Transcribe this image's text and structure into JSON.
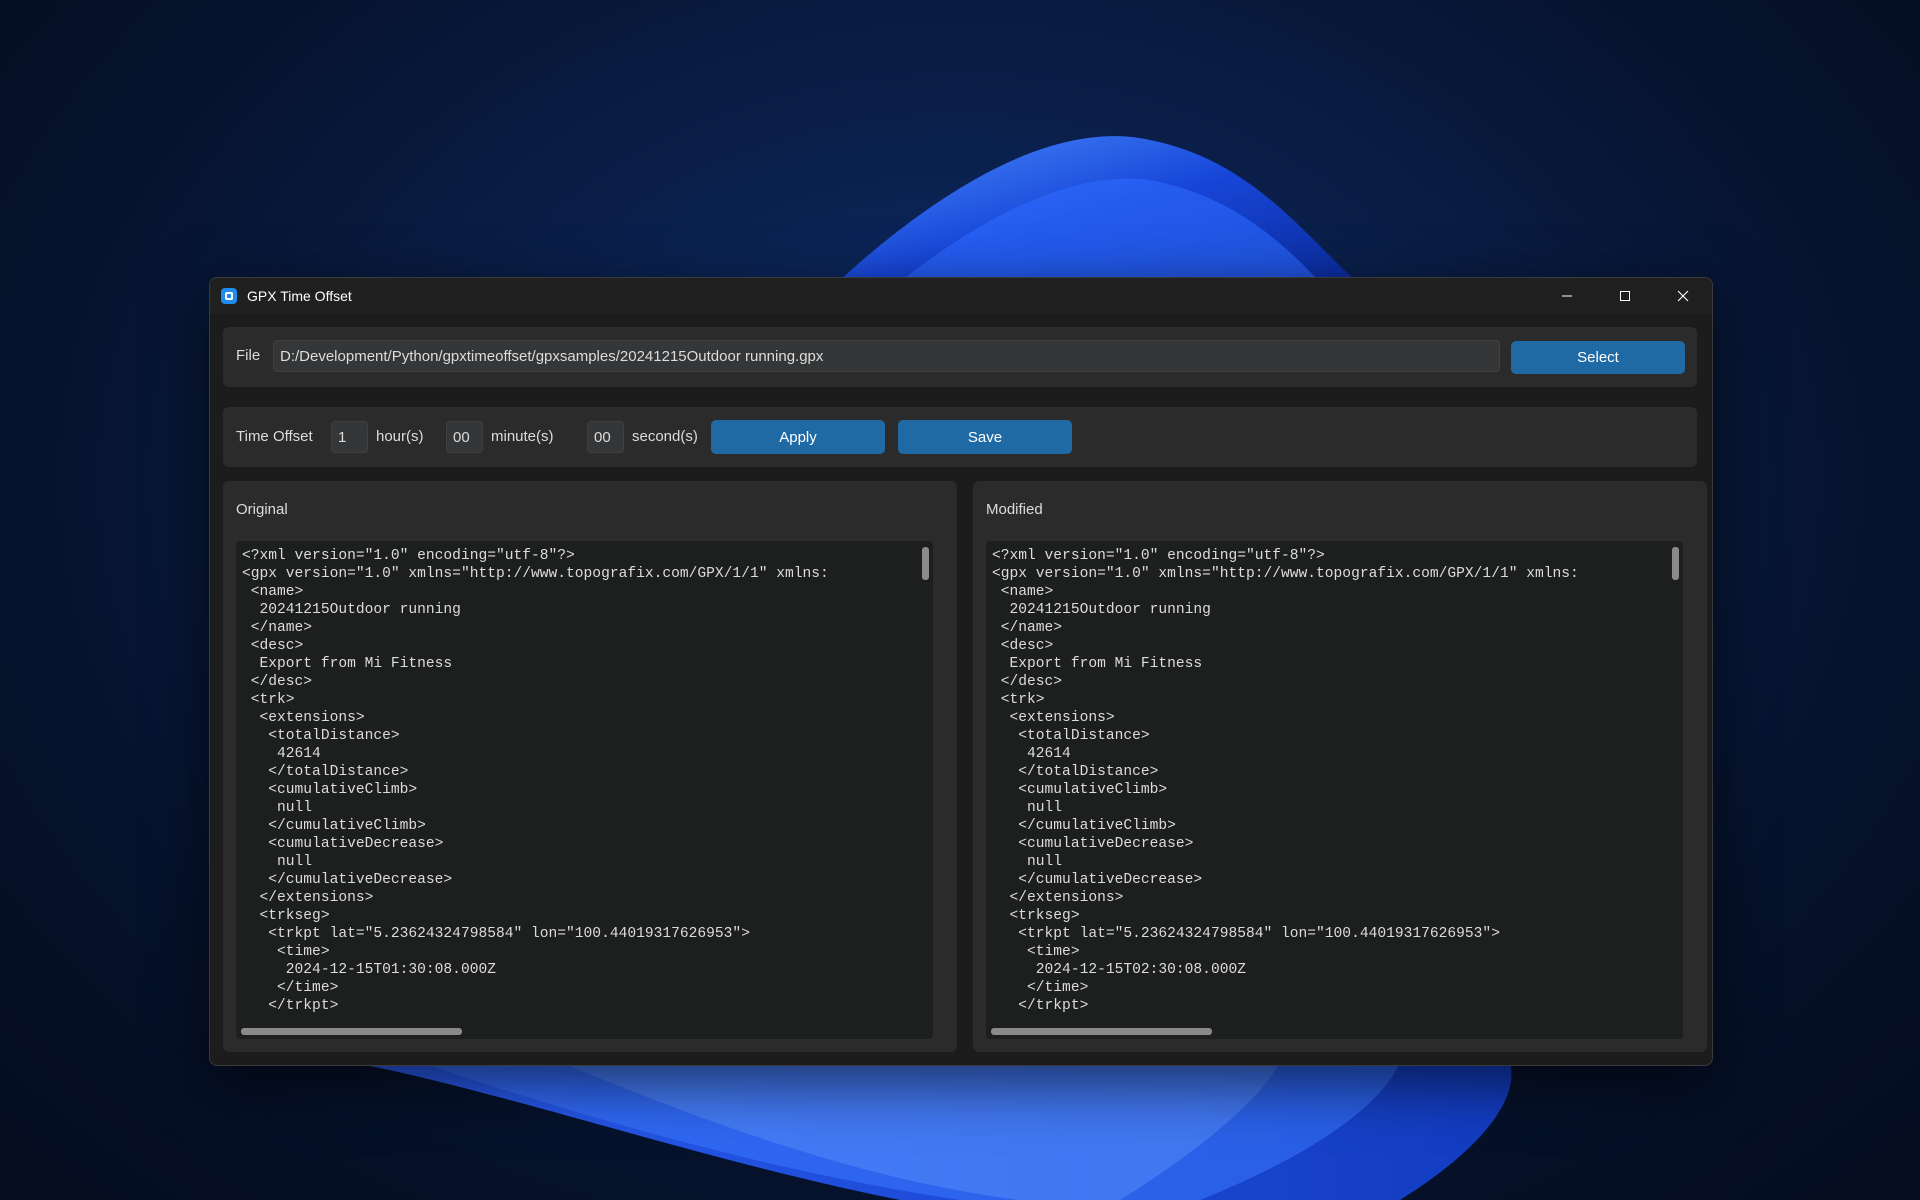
{
  "window": {
    "title": "GPX Time Offset",
    "controls": {
      "minimize": "minimize-icon",
      "maximize": "maximize-icon",
      "close": "close-icon"
    }
  },
  "file_row": {
    "label": "File",
    "path": "D:/Development/Python/gpxtimeoffset/gpxsamples/20241215Outdoor running.gpx",
    "select_label": "Select"
  },
  "offset_row": {
    "label": "Time Offset",
    "hours": "1",
    "hours_unit": "hour(s)",
    "minutes": "00",
    "minutes_unit": "minute(s)",
    "seconds": "00",
    "seconds_unit": "second(s)",
    "apply_label": "Apply",
    "save_label": "Save"
  },
  "original": {
    "title": "Original",
    "lines": [
      "<?xml version=\"1.0\" encoding=\"utf-8\"?>",
      "<gpx version=\"1.0\" xmlns=\"http://www.topografix.com/GPX/1/1\" xmlns:",
      " <name>",
      "  20241215Outdoor running",
      " </name>",
      " <desc>",
      "  Export from Mi Fitness",
      " </desc>",
      " <trk>",
      "  <extensions>",
      "   <totalDistance>",
      "    42614",
      "   </totalDistance>",
      "   <cumulativeClimb>",
      "    null",
      "   </cumulativeClimb>",
      "   <cumulativeDecrease>",
      "    null",
      "   </cumulativeDecrease>",
      "  </extensions>",
      "  <trkseg>",
      "   <trkpt lat=\"5.23624324798584\" lon=\"100.44019317626953\">",
      "    <time>",
      "     2024-12-15T01:30:08.000Z",
      "    </time>",
      "   </trkpt>"
    ]
  },
  "modified": {
    "title": "Modified",
    "lines": [
      "<?xml version=\"1.0\" encoding=\"utf-8\"?>",
      "<gpx version=\"1.0\" xmlns=\"http://www.topografix.com/GPX/1/1\" xmlns:",
      " <name>",
      "  20241215Outdoor running",
      " </name>",
      " <desc>",
      "  Export from Mi Fitness",
      " </desc>",
      " <trk>",
      "  <extensions>",
      "   <totalDistance>",
      "    42614",
      "   </totalDistance>",
      "   <cumulativeClimb>",
      "    null",
      "   </cumulativeClimb>",
      "   <cumulativeDecrease>",
      "    null",
      "   </cumulativeDecrease>",
      "  </extensions>",
      "  <trkseg>",
      "   <trkpt lat=\"5.23624324798584\" lon=\"100.44019317626953\">",
      "    <time>",
      "     2024-12-15T02:30:08.000Z",
      "    </time>",
      "   </trkpt>"
    ]
  },
  "colors": {
    "accent_button": "#1f6aa5",
    "window_bg": "#1c1c1c",
    "frame_bg": "#2b2b2b",
    "textbox_bg": "#1d1e1e"
  }
}
